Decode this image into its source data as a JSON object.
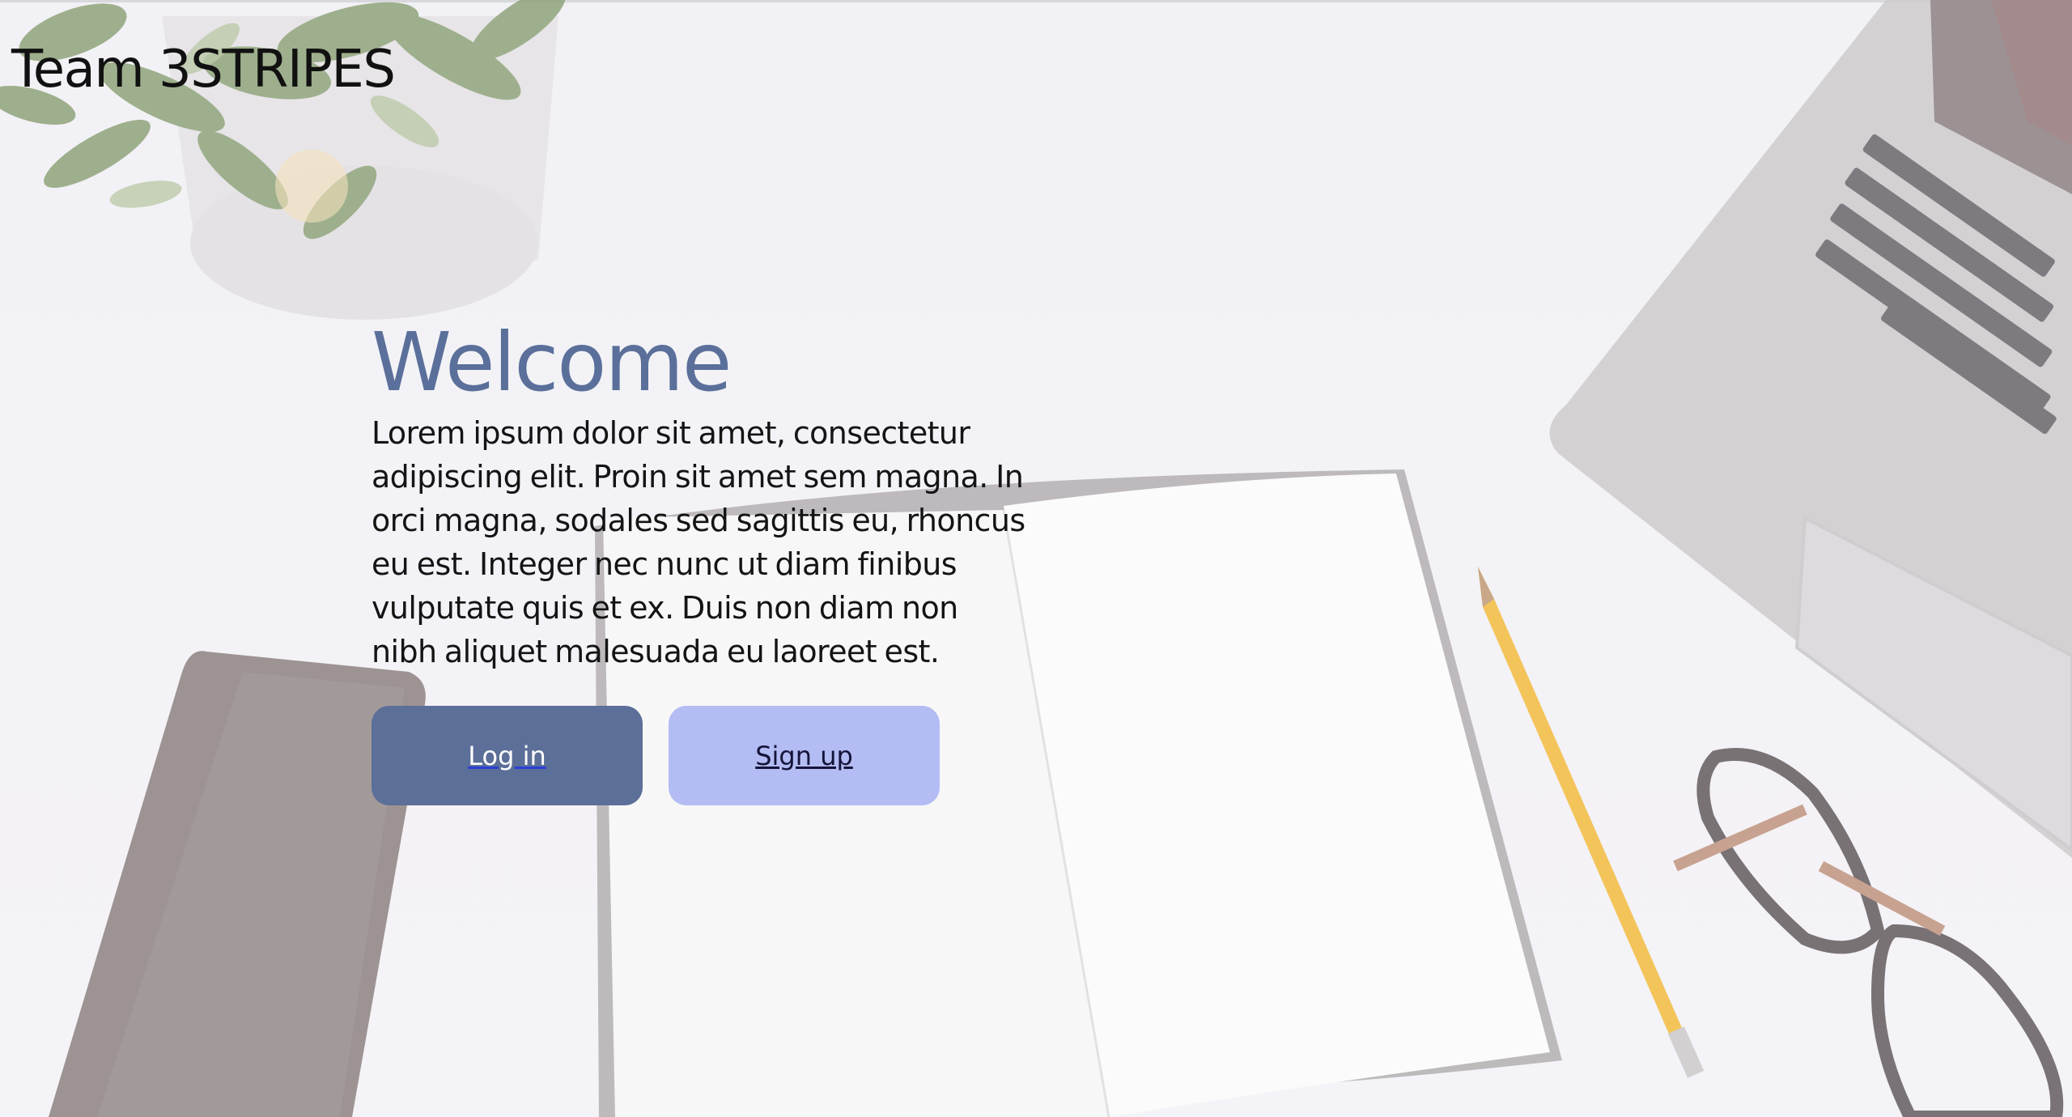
{
  "header": {
    "brand": "Team 3STRIPES"
  },
  "hero": {
    "title": "Welcome",
    "text": "Lorem ipsum dolor sit amet, consectetur adipiscing elit. Proin sit amet sem magna. In orci magna, sodales sed sagittis eu, rhoncus eu est. Integer nec nunc ut diam finibus vulputate quis et ex. Duis non diam non nibh aliquet malesuada eu laoreet est."
  },
  "actions": {
    "login_label": "Log in",
    "signup_label": "Sign up"
  },
  "colors": {
    "title": "#5a6f9a",
    "login_button": "#5b6f98",
    "signup_button": "#b4bcf4",
    "background": "#f2f1f5"
  }
}
